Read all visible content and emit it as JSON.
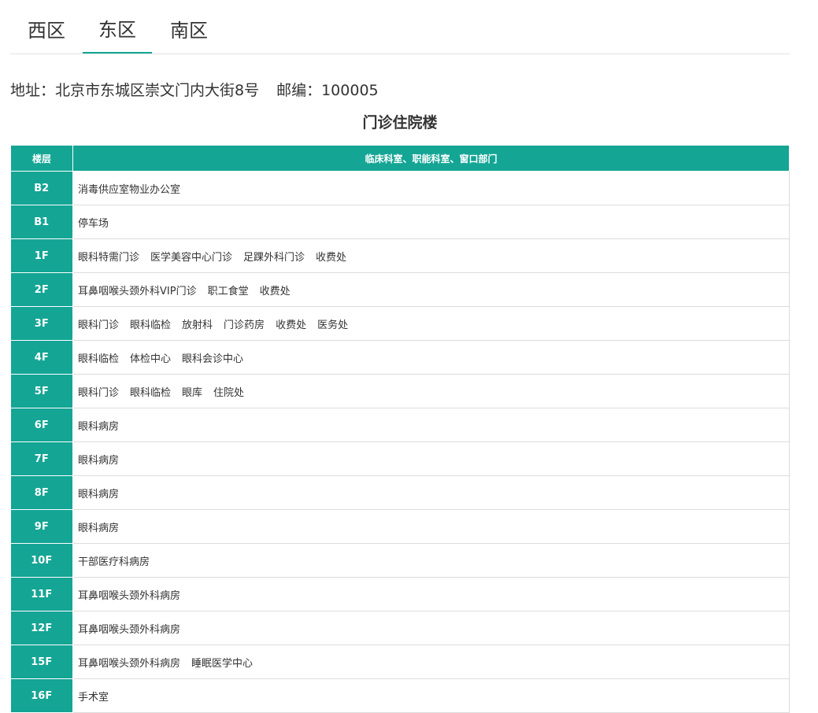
{
  "tabs": [
    {
      "label": "西区",
      "active": false
    },
    {
      "label": "东区",
      "active": true
    },
    {
      "label": "南区",
      "active": false
    }
  ],
  "address": {
    "text": "地址：北京市东城区崇文门内大街8号",
    "postcode": "邮编：100005"
  },
  "building_title": "门诊住院楼",
  "table": {
    "headers": {
      "floor": "楼层",
      "departments": "临床科室、职能科室、窗口部门"
    },
    "rows": [
      {
        "floor": "B2",
        "departments": [
          "消毒供应室物业办公室"
        ]
      },
      {
        "floor": "B1",
        "departments": [
          "停车场"
        ]
      },
      {
        "floor": "1F",
        "departments": [
          "眼科特需门诊",
          "医学美容中心门诊",
          "足踝外科门诊",
          "收费处"
        ]
      },
      {
        "floor": "2F",
        "departments": [
          "耳鼻咽喉头颈外科VIP门诊",
          "职工食堂",
          "收费处"
        ]
      },
      {
        "floor": "3F",
        "departments": [
          "眼科门诊",
          "眼科临检",
          "放射科",
          "门诊药房",
          "收费处",
          "医务处"
        ]
      },
      {
        "floor": "4F",
        "departments": [
          "眼科临检",
          "体检中心",
          "眼科会诊中心"
        ]
      },
      {
        "floor": "5F",
        "departments": [
          "眼科门诊",
          "眼科临检",
          "眼库",
          "住院处"
        ]
      },
      {
        "floor": "6F",
        "departments": [
          "眼科病房"
        ]
      },
      {
        "floor": "7F",
        "departments": [
          "眼科病房"
        ]
      },
      {
        "floor": "8F",
        "departments": [
          "眼科病房"
        ]
      },
      {
        "floor": "9F",
        "departments": [
          "眼科病房"
        ]
      },
      {
        "floor": "10F",
        "departments": [
          "干部医疗科病房"
        ]
      },
      {
        "floor": "11F",
        "departments": [
          "耳鼻咽喉头颈外科病房"
        ]
      },
      {
        "floor": "12F",
        "departments": [
          "耳鼻咽喉头颈外科病房"
        ]
      },
      {
        "floor": "15F",
        "departments": [
          "耳鼻咽喉头颈外科病房",
          "睡眠医学中心"
        ]
      },
      {
        "floor": "16F",
        "departments": [
          "手术室"
        ]
      }
    ]
  },
  "colors": {
    "accent": "#14a595",
    "text": "#333333",
    "border": "#dcdcdc"
  }
}
